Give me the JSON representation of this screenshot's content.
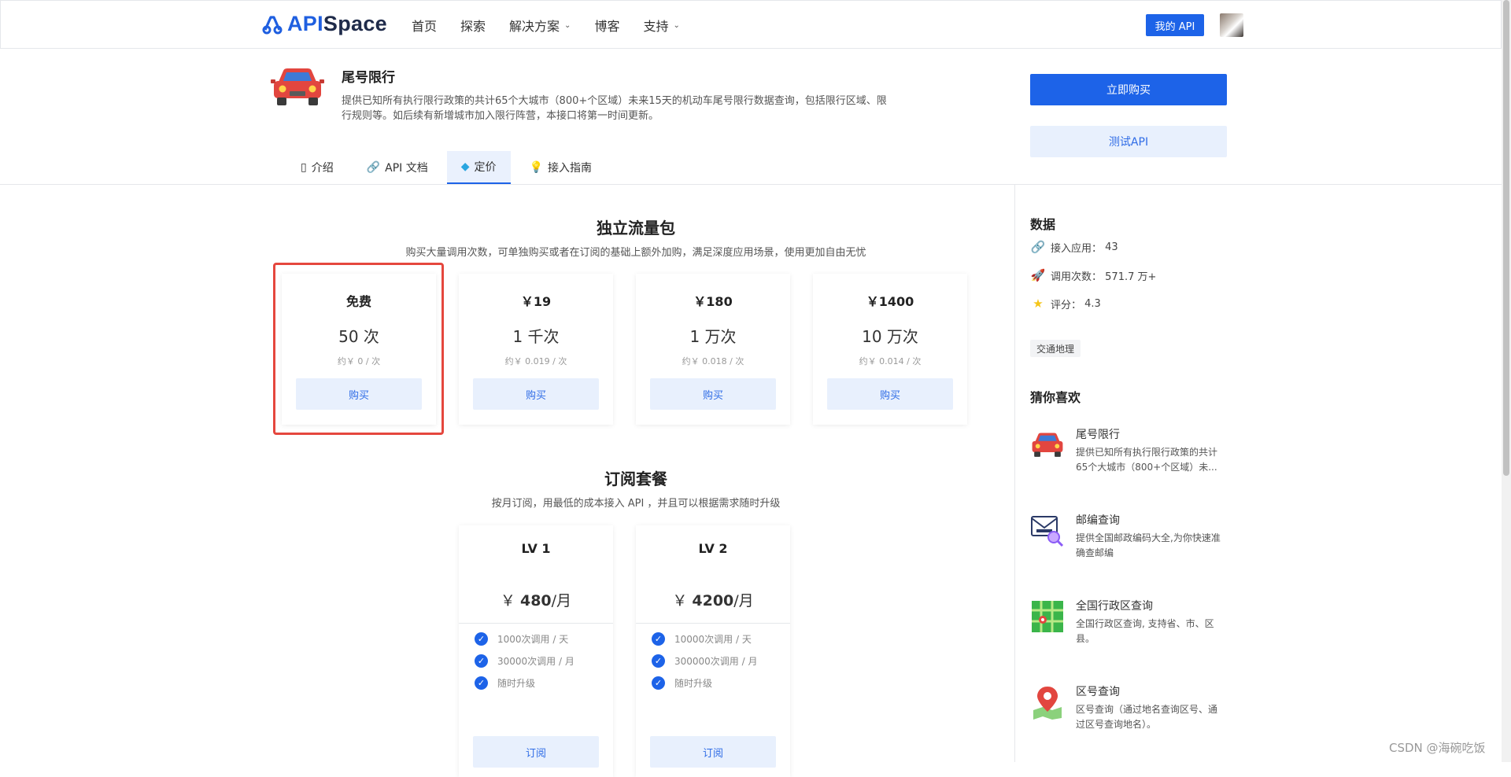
{
  "header": {
    "logo_api": "API",
    "logo_space": "Space",
    "nav": [
      "首页",
      "探索",
      "解决方案",
      "博客",
      "支持"
    ],
    "my_api_label": "我的 API"
  },
  "product": {
    "title": "尾号限行",
    "description": "提供已知所有执行限行政策的共计65个大城市（800+个区域）未来15天的机动车尾号限行数据查询，包括限行区域、限行规则等。如后续有新增城市加入限行阵营，本接口将第一时间更新。",
    "buy_now_label": "立即购买",
    "test_api_label": "测试API"
  },
  "tabs": [
    {
      "label": "介绍",
      "icon": "document-icon",
      "active": false
    },
    {
      "label": "API 文档",
      "icon": "link-icon",
      "active": false
    },
    {
      "label": "定价",
      "icon": "diamond-icon",
      "active": true
    },
    {
      "label": "接入指南",
      "icon": "lightbulb-icon",
      "active": false
    }
  ],
  "traffic_section": {
    "title": "独立流量包",
    "subtitle": "购买大量调用次数，可单独购买或者在订阅的基础上额外加购，满足深度应用场景，使用更加自由无忧",
    "cards": [
      {
        "price": "免费",
        "count": "50 次",
        "unit_price": "约￥ 0 / 次",
        "buy_label": "购买"
      },
      {
        "price": "￥19",
        "count": "1 千次",
        "unit_price": "约￥ 0.019 / 次",
        "buy_label": "购买"
      },
      {
        "price": "￥180",
        "count": "1 万次",
        "unit_price": "约￥ 0.018 / 次",
        "buy_label": "购买"
      },
      {
        "price": "￥1400",
        "count": "10 万次",
        "unit_price": "约￥ 0.014 / 次",
        "buy_label": "购买"
      }
    ]
  },
  "subscription_section": {
    "title": "订阅套餐",
    "subtitle": "按月订阅，用最低的成本接入 API ，并且可以根据需求随时升级",
    "plans": [
      {
        "level": "LV 1",
        "currency": "￥",
        "amount": "480",
        "period": "/月",
        "features": [
          "1000次调用 / 天",
          "30000次调用 / 月",
          "随时升级"
        ],
        "button": "订阅"
      },
      {
        "level": "LV 2",
        "currency": "￥",
        "amount": "4200",
        "period": "/月",
        "features": [
          "10000次调用 / 天",
          "300000次调用 / 月",
          "随时升级"
        ],
        "button": "订阅"
      }
    ]
  },
  "sidebar": {
    "data_title": "数据",
    "stats": [
      {
        "label": "接入应用：",
        "value": "43",
        "icon": "link-icon"
      },
      {
        "label": "调用次数：",
        "value": "571.7 万+",
        "icon": "rocket-icon"
      },
      {
        "label": "评分：",
        "value": "4.3",
        "icon": "star-icon"
      }
    ],
    "tag": "交通地理",
    "recommend_title": "猜你喜欢",
    "recommendations": [
      {
        "title": "尾号限行",
        "desc": "提供已知所有执行限行政策的共计65个大城市（800+个区域）未...",
        "icon": "car-icon"
      },
      {
        "title": "邮编查询",
        "desc": "提供全国邮政编码大全,为你快速准确查邮编",
        "icon": "mail-search-icon"
      },
      {
        "title": "全国行政区查询",
        "desc": "全国行政区查询, 支持省、市、区县。",
        "icon": "map-grid-icon"
      },
      {
        "title": "区号查询",
        "desc": "区号查询（通过地名查询区号、通过区号查询地名）。",
        "icon": "map-pin-icon"
      }
    ]
  },
  "watermark": "CSDN @海碗吃饭",
  "colors": {
    "primary": "#1d63e8",
    "light_primary": "#e8f0fd",
    "highlight_border": "#e5473e"
  }
}
